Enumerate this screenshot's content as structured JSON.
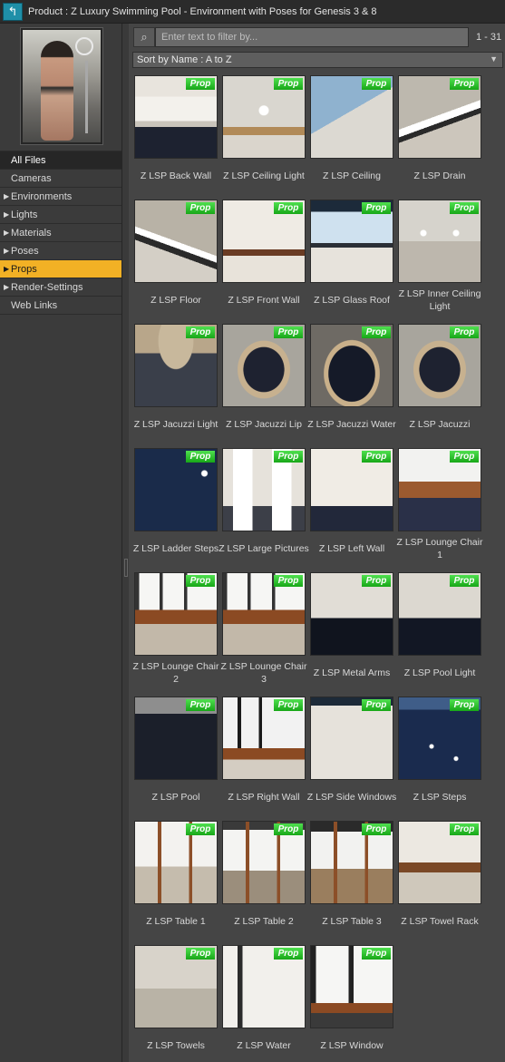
{
  "titlebar": {
    "back_icon": "back-arrow-icon",
    "title": "Product :  Z Luxury Swimming Pool - Environment with Poses for Genesis 3 & 8"
  },
  "sidebar": {
    "items": [
      {
        "label": "All Files",
        "has_children": false,
        "state": "selected"
      },
      {
        "label": "Cameras",
        "has_children": false,
        "state": "normal"
      },
      {
        "label": "Environments",
        "has_children": true,
        "state": "normal"
      },
      {
        "label": "Lights",
        "has_children": true,
        "state": "normal"
      },
      {
        "label": "Materials",
        "has_children": true,
        "state": "normal"
      },
      {
        "label": "Poses",
        "has_children": true,
        "state": "normal"
      },
      {
        "label": "Props",
        "has_children": true,
        "state": "active"
      },
      {
        "label": "Render-Settings",
        "has_children": true,
        "state": "normal"
      },
      {
        "label": "Web Links",
        "has_children": false,
        "state": "normal"
      }
    ]
  },
  "filter": {
    "placeholder": "Enter text to filter by...",
    "count": "1 - 31",
    "search_icon": "magnifier-icon"
  },
  "sort": {
    "label": "Sort by Name : A to Z",
    "dropdown_icon": "dropdown-arrow-icon"
  },
  "badge_label": "Prop",
  "colors": {
    "accent_active": "#f2b125",
    "badge_green": "#22b022",
    "back_button": "#1f8fa8"
  },
  "items": [
    {
      "label": "Z LSP Back Wall"
    },
    {
      "label": "Z LSP Ceiling Light"
    },
    {
      "label": "Z LSP Ceiling"
    },
    {
      "label": "Z LSP Drain"
    },
    {
      "label": "Z LSP Floor"
    },
    {
      "label": "Z LSP Front Wall"
    },
    {
      "label": "Z LSP Glass Roof"
    },
    {
      "label": "Z LSP Inner Ceiling Light"
    },
    {
      "label": "Z LSP Jacuzzi Light"
    },
    {
      "label": "Z LSP Jacuzzi Lip"
    },
    {
      "label": "Z LSP Jacuzzi Water"
    },
    {
      "label": "Z LSP Jacuzzi"
    },
    {
      "label": "Z LSP Ladder Steps"
    },
    {
      "label": "Z LSP Large Pictures"
    },
    {
      "label": "Z LSP Left Wall"
    },
    {
      "label": "Z LSP Lounge Chair 1"
    },
    {
      "label": "Z LSP Lounge Chair 2"
    },
    {
      "label": "Z LSP Lounge Chair 3"
    },
    {
      "label": "Z LSP Metal Arms"
    },
    {
      "label": "Z LSP Pool Light"
    },
    {
      "label": "Z LSP Pool"
    },
    {
      "label": "Z LSP Right Wall"
    },
    {
      "label": "Z LSP Side Windows"
    },
    {
      "label": "Z LSP Steps"
    },
    {
      "label": "Z LSP Table 1"
    },
    {
      "label": "Z LSP Table 2"
    },
    {
      "label": "Z LSP Table 3"
    },
    {
      "label": "Z LSP Towel Rack"
    },
    {
      "label": "Z LSP Towels"
    },
    {
      "label": "Z LSP Water"
    },
    {
      "label": "Z LSP Window"
    }
  ]
}
